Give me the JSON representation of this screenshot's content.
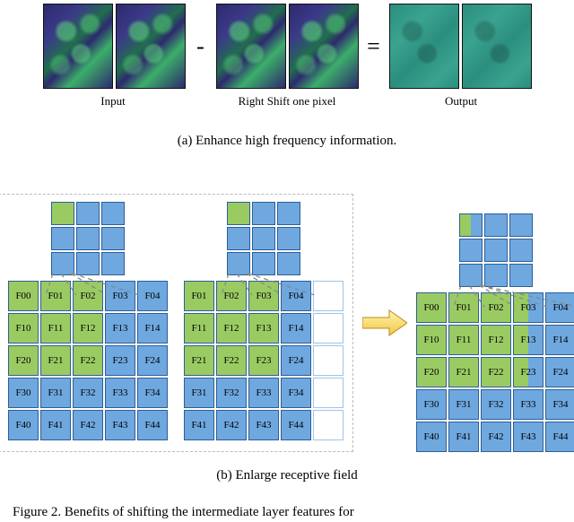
{
  "panel_a": {
    "minus": "-",
    "equals": "=",
    "label_input": "Input",
    "label_shift": "Right Shift one pixel",
    "label_output": "Output",
    "caption": "(a) Enhance high frequency information."
  },
  "panel_b": {
    "caption": "(b) Enlarge receptive field",
    "grid1_cells": [
      "F00",
      "F01",
      "F02",
      "F03",
      "F04",
      "F10",
      "F11",
      "F12",
      "F13",
      "F14",
      "F20",
      "F21",
      "F22",
      "F23",
      "F24",
      "F30",
      "F31",
      "F32",
      "F33",
      "F34",
      "F40",
      "F41",
      "F42",
      "F43",
      "F44"
    ],
    "grid2_cells": [
      "F01",
      "F02",
      "F03",
      "F04",
      "",
      "F11",
      "F12",
      "F13",
      "F14",
      "",
      "F21",
      "F22",
      "F23",
      "F24",
      "",
      "F31",
      "F32",
      "F33",
      "F34",
      "",
      "F41",
      "F42",
      "F43",
      "F44",
      ""
    ],
    "grid3_cells": [
      "F00",
      "F01",
      "F02",
      "F03",
      "F04",
      "F10",
      "F11",
      "F12",
      "F13",
      "F14",
      "F20",
      "F21",
      "F22",
      "F23",
      "F24",
      "F30",
      "F31",
      "F32",
      "F33",
      "F34",
      "F40",
      "F41",
      "F42",
      "F43",
      "F44"
    ]
  },
  "figure_caption": "Figure 2. Benefits of shifting the intermediate layer features for"
}
